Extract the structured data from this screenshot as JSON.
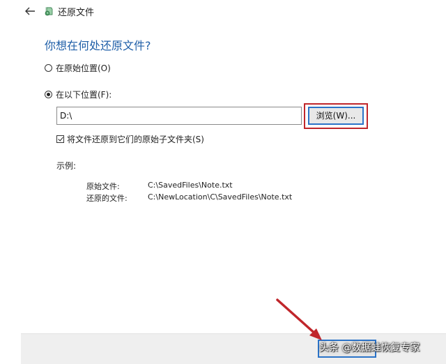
{
  "window": {
    "title": "还原文件"
  },
  "icons": {
    "back": "back-arrow-icon",
    "app": "file-history-icon"
  },
  "main": {
    "heading": "你想在何处还原文件?"
  },
  "options": {
    "original_location": {
      "label": "在原始位置(O)",
      "selected": false
    },
    "other_location": {
      "label": "在以下位置(F):",
      "selected": true
    }
  },
  "path": {
    "value": "D:\\"
  },
  "browse_button": {
    "label": "浏览(W)..."
  },
  "restore_subfolder": {
    "label": "将文件还原到它们的原始子文件夹(S)",
    "checked": true
  },
  "example": {
    "label": "示例:",
    "rows": [
      {
        "key": "原始文件:",
        "value": "C:\\SavedFiles\\Note.txt"
      },
      {
        "key": "还原的文件:",
        "value": "C:\\NewLocation\\C\\SavedFiles\\Note.txt"
      }
    ]
  },
  "watermark": {
    "text": "头条 @数据蛙恢复专家"
  },
  "colors": {
    "heading_blue": "#1f5fa8",
    "focus_blue": "#2b73c8",
    "highlight_red": "#c0262b"
  }
}
